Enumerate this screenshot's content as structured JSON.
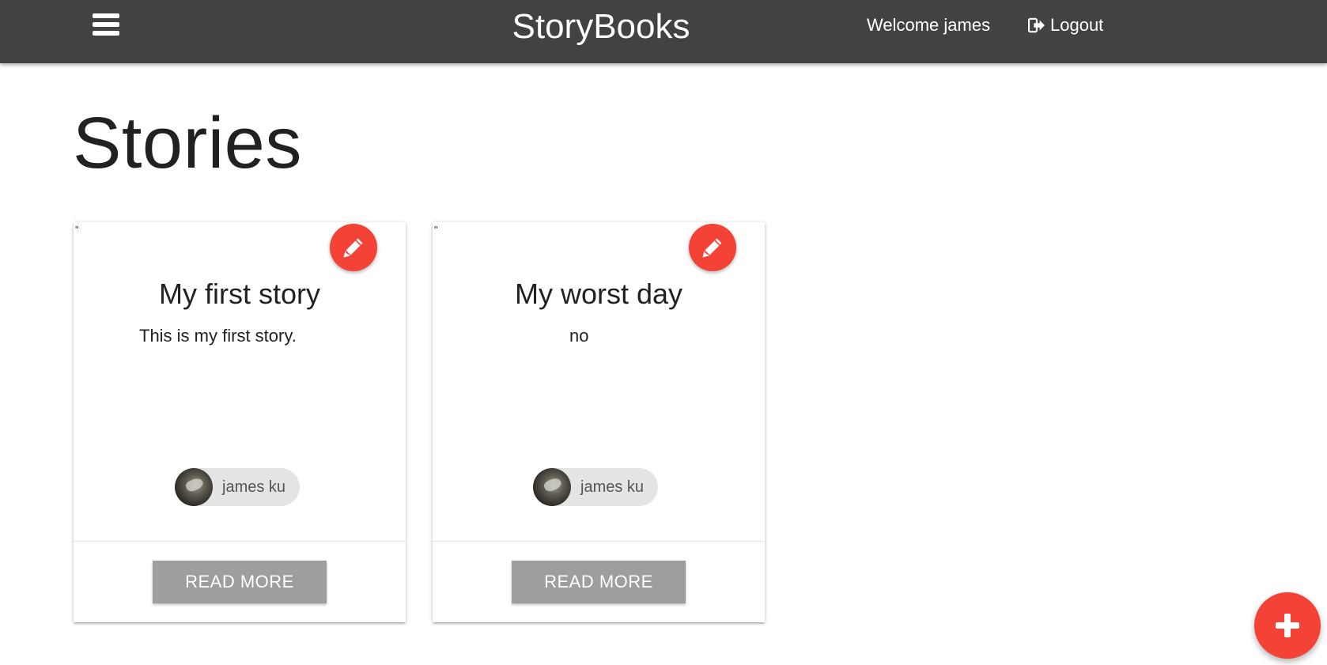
{
  "navbar": {
    "brand": "StoryBooks",
    "welcome": "Welcome james",
    "logout_label": "Logout",
    "background": "#424242"
  },
  "page": {
    "title": "Stories"
  },
  "stories": [
    {
      "quote_mark": "\"",
      "title": "My first story",
      "body": "This is my first story.",
      "author": "james ku",
      "read_more_label": "READ MORE"
    },
    {
      "quote_mark": "\"",
      "title": "My worst day",
      "body": "no",
      "author": "james ku",
      "read_more_label": "READ MORE"
    }
  ],
  "colors": {
    "accent": "#f44336",
    "button_grey": "#9e9e9e",
    "chip_bg": "#e4e4e4"
  },
  "icons": {
    "menu": "menu-icon",
    "logout": "sign-out-icon",
    "edit": "pencil-icon",
    "add": "plus-icon"
  }
}
